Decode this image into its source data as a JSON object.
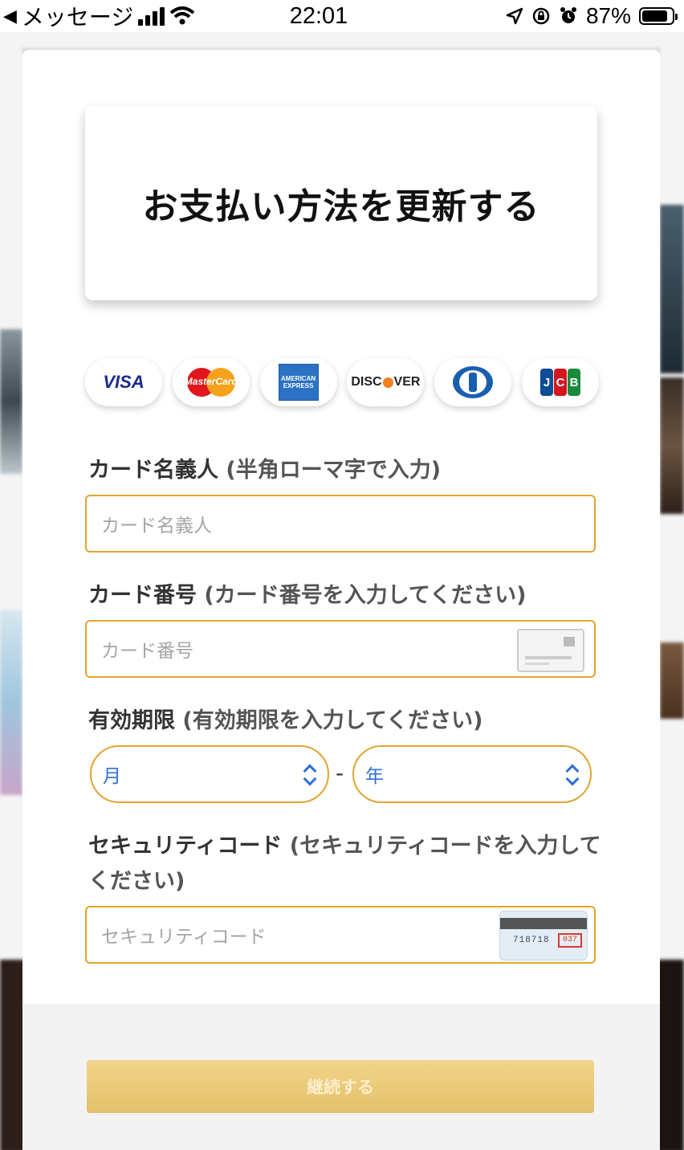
{
  "status_bar": {
    "back_app": "メッセージ",
    "time": "22:01",
    "battery_percent": "87%",
    "battery_level": 0.87
  },
  "modal": {
    "title": "お支払い方法を更新する",
    "brands": [
      {
        "name": "VISA",
        "icon": "visa-logo"
      },
      {
        "name": "MasterCard",
        "icon": "mastercard-logo"
      },
      {
        "name": "AMERICAN EXPRESS",
        "icon": "amex-logo"
      },
      {
        "name": "DISCOVER",
        "icon": "discover-logo"
      },
      {
        "name": "Diners Club",
        "icon": "diners-logo"
      },
      {
        "name": "JCB",
        "icon": "jcb-logo"
      }
    ],
    "card_holder": {
      "label": "カード名義人",
      "hint": "(半角ローマ字で入力)",
      "placeholder": "カード名義人"
    },
    "card_number": {
      "label": "カード番号",
      "hint": "(カード番号を入力してください)",
      "placeholder": "カード番号"
    },
    "expiry": {
      "label": "有効期限",
      "hint": "(有効期限を入力してください)",
      "month_value": "月",
      "separator": "-",
      "year_value": "年"
    },
    "security_code": {
      "label": "セキュリティコード",
      "hint": "(セキュリティコードを入力してください)",
      "placeholder": "セキュリティコード",
      "sample_number": "718718",
      "sample_cvv": "037"
    },
    "continue_label": "継続する"
  },
  "colors": {
    "accent_border": "#e2a530",
    "select_text": "#2f6fd6",
    "button_bg": "#ecc979"
  }
}
